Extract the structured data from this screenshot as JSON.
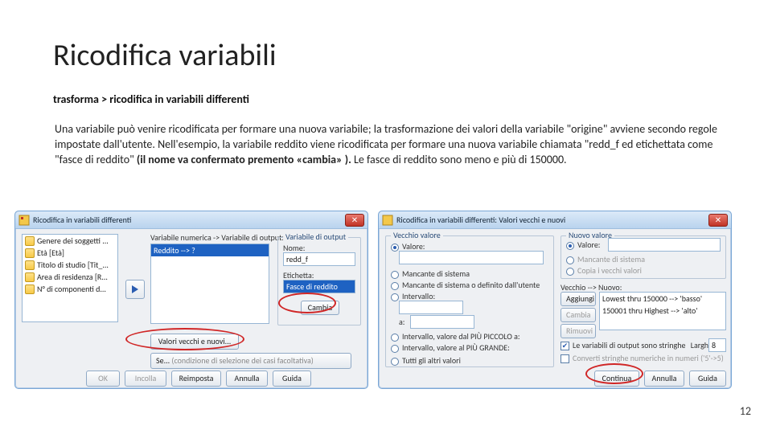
{
  "slide": {
    "title": "Ricodifica variabili",
    "subtitle": "trasforma > ricodifica in variabili differenti",
    "body_prefix": "Una variabile può venire ricodificata per formare una nuova variabile; la trasformazione dei valori della variabile \"origine\" avviene secondo regole impostate dall'utente. Nell'esempio, la variabile reddito viene ricodificata per formare una nuova variabile chiamata \"redd_f ed etichettata come \"fasce di reddito\" ",
    "body_bold": "(il nome va confermato premento «cambia» ).",
    "body_suffix": " Le fasce di reddito sono meno e più di 150000.",
    "page_number": "12"
  },
  "dlg1": {
    "title": "Ricodifica in variabili differenti",
    "vars": [
      "Genere dei soggetti ...",
      "Età [Età]",
      "Titolo di studio [Tit_...",
      "Area di residenza [R...",
      "N° di componenti d..."
    ],
    "center_header": "Variabile numerica -> Variabile di output:",
    "center_value": "Reddito --> ?",
    "output": {
      "group_label": "Variabile di output",
      "name_label": "Nome:",
      "name_value": "redd_f",
      "etichetta_label": "Etichetta:",
      "etichetta_value": "Fasce di reddito",
      "cambia": "Cambia"
    },
    "btn_valori": "Valori vecchi e nuovi...",
    "btn_se_prefix": "Se...",
    "btn_se_suffix": "(condizione di selezione dei casi facoltativa)",
    "footer": {
      "ok": "OK",
      "incolla": "Incolla",
      "reimposta": "Reimposta",
      "annulla": "Annulla",
      "guida": "Guida"
    }
  },
  "dlg2": {
    "title": "Ricodifica in variabili differenti: Valori vecchi e nuovi",
    "old": {
      "group_label": "Vecchio valore",
      "valore": "Valore:",
      "mancante": "Mancante di sistema",
      "mancante_utente": "Mancante di sistema o definito dall'utente",
      "intervallo": "Intervallo:",
      "a": "a:",
      "int_piccolo": "Intervallo, valore dal PIÙ PICCOLO a:",
      "int_grande": "Intervallo, valore al PIÙ GRANDE:",
      "tutti": "Tutti gli altri valori"
    },
    "new": {
      "group_label": "Nuovo valore",
      "valore": "Valore:",
      "mancante": "Mancante di sistema",
      "copia": "Copia i vecchi valori"
    },
    "map": {
      "header": "Vecchio --> Nuovo:",
      "rows": [
        "Lowest thru 150000 --> 'basso'",
        "150001 thru Highest --> 'alto'"
      ],
      "aggiungi": "Aggiungi",
      "cambia": "Cambia",
      "rimuovi": "Rimuovi"
    },
    "opts": {
      "stringhe": "Le variabili di output sono stringhe",
      "larghezza_label": "Larghezza:",
      "larghezza_value": "8",
      "converti": "Converti stringhe numeriche in numeri ('5'->5)"
    },
    "footer": {
      "continua": "Continua",
      "annulla": "Annulla",
      "guida": "Guida"
    }
  }
}
